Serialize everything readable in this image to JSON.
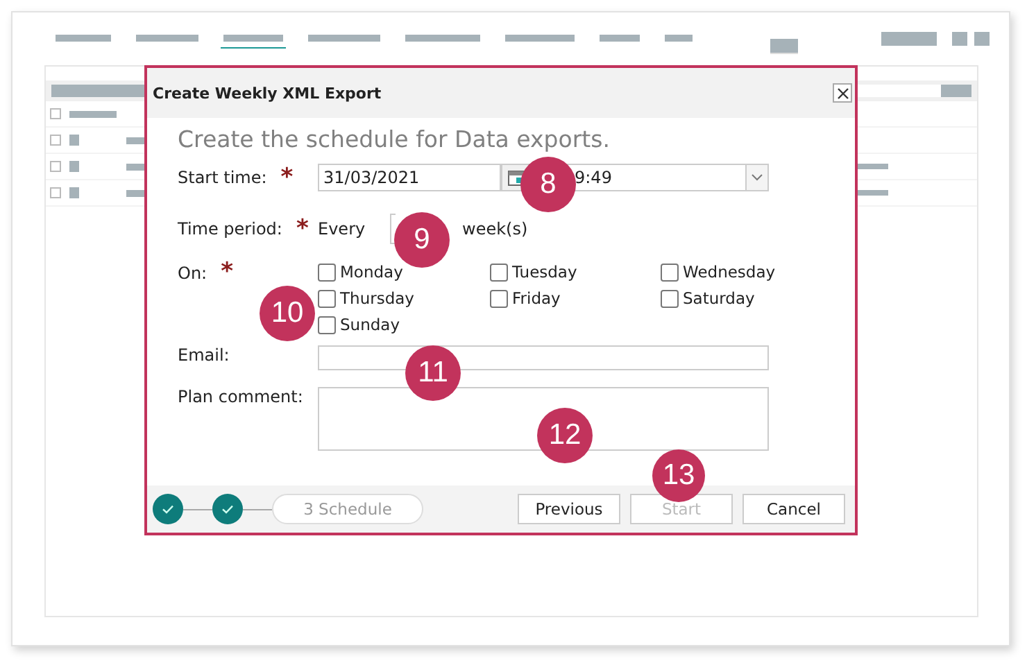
{
  "background": {
    "nav_tabs": [
      {
        "selected": false
      },
      {
        "selected": false
      },
      {
        "selected": true
      },
      {
        "selected": false
      },
      {
        "selected": false
      },
      {
        "selected": false
      },
      {
        "selected": false
      },
      {
        "selected": false
      }
    ],
    "rows": [
      {
        "checked": false
      },
      {
        "checked": false
      },
      {
        "checked": false
      },
      {
        "checked": false
      }
    ]
  },
  "dialog": {
    "title": "Create Weekly XML Export",
    "heading": "Create the schedule for Data exports.",
    "start_time": {
      "label": "Start time:",
      "required_mark": "*",
      "date": "31/03/2021",
      "time": "9:49"
    },
    "time_period": {
      "label": "Time period:",
      "required_mark": "*",
      "prefix": "Every",
      "suffix": "week(s)"
    },
    "on": {
      "label": "On:",
      "required_mark": "*",
      "days": [
        {
          "label": "Monday",
          "checked": false
        },
        {
          "label": "Tuesday",
          "checked": false
        },
        {
          "label": "Wednesday",
          "checked": false
        },
        {
          "label": "Thursday",
          "checked": false
        },
        {
          "label": "Friday",
          "checked": false
        },
        {
          "label": "Saturday",
          "checked": false
        },
        {
          "label": "Sunday",
          "checked": false
        }
      ]
    },
    "email": {
      "label": "Email:"
    },
    "plan_comment": {
      "label": "Plan comment:"
    },
    "steps": [
      {
        "done": true
      },
      {
        "done": true
      },
      {
        "done": false,
        "label": "3 Schedule"
      }
    ],
    "buttons": [
      {
        "label": "Previous",
        "disabled": false
      },
      {
        "label": "Start",
        "disabled": true
      },
      {
        "label": "Cancel",
        "disabled": false
      }
    ]
  },
  "callouts": [
    "8",
    "9",
    "10",
    "11",
    "12",
    "13"
  ]
}
